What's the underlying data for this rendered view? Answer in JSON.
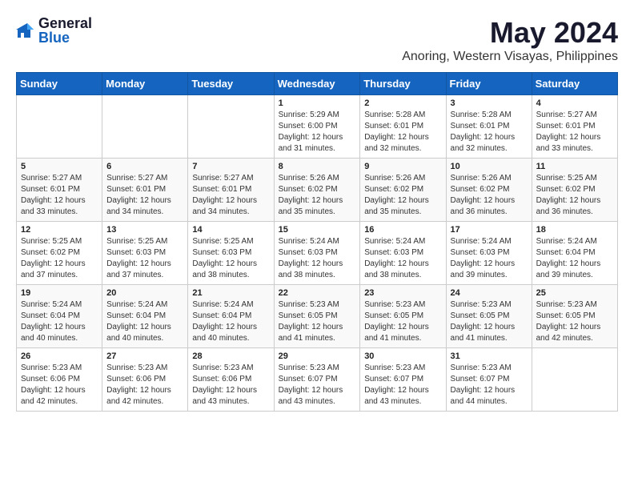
{
  "logo": {
    "general": "General",
    "blue": "Blue"
  },
  "title": "May 2024",
  "location": "Anoring, Western Visayas, Philippines",
  "weekdays": [
    "Sunday",
    "Monday",
    "Tuesday",
    "Wednesday",
    "Thursday",
    "Friday",
    "Saturday"
  ],
  "weeks": [
    [
      {
        "day": "",
        "info": ""
      },
      {
        "day": "",
        "info": ""
      },
      {
        "day": "",
        "info": ""
      },
      {
        "day": "1",
        "info": "Sunrise: 5:29 AM\nSunset: 6:00 PM\nDaylight: 12 hours\nand 31 minutes."
      },
      {
        "day": "2",
        "info": "Sunrise: 5:28 AM\nSunset: 6:01 PM\nDaylight: 12 hours\nand 32 minutes."
      },
      {
        "day": "3",
        "info": "Sunrise: 5:28 AM\nSunset: 6:01 PM\nDaylight: 12 hours\nand 32 minutes."
      },
      {
        "day": "4",
        "info": "Sunrise: 5:27 AM\nSunset: 6:01 PM\nDaylight: 12 hours\nand 33 minutes."
      }
    ],
    [
      {
        "day": "5",
        "info": "Sunrise: 5:27 AM\nSunset: 6:01 PM\nDaylight: 12 hours\nand 33 minutes."
      },
      {
        "day": "6",
        "info": "Sunrise: 5:27 AM\nSunset: 6:01 PM\nDaylight: 12 hours\nand 34 minutes."
      },
      {
        "day": "7",
        "info": "Sunrise: 5:27 AM\nSunset: 6:01 PM\nDaylight: 12 hours\nand 34 minutes."
      },
      {
        "day": "8",
        "info": "Sunrise: 5:26 AM\nSunset: 6:02 PM\nDaylight: 12 hours\nand 35 minutes."
      },
      {
        "day": "9",
        "info": "Sunrise: 5:26 AM\nSunset: 6:02 PM\nDaylight: 12 hours\nand 35 minutes."
      },
      {
        "day": "10",
        "info": "Sunrise: 5:26 AM\nSunset: 6:02 PM\nDaylight: 12 hours\nand 36 minutes."
      },
      {
        "day": "11",
        "info": "Sunrise: 5:25 AM\nSunset: 6:02 PM\nDaylight: 12 hours\nand 36 minutes."
      }
    ],
    [
      {
        "day": "12",
        "info": "Sunrise: 5:25 AM\nSunset: 6:02 PM\nDaylight: 12 hours\nand 37 minutes."
      },
      {
        "day": "13",
        "info": "Sunrise: 5:25 AM\nSunset: 6:03 PM\nDaylight: 12 hours\nand 37 minutes."
      },
      {
        "day": "14",
        "info": "Sunrise: 5:25 AM\nSunset: 6:03 PM\nDaylight: 12 hours\nand 38 minutes."
      },
      {
        "day": "15",
        "info": "Sunrise: 5:24 AM\nSunset: 6:03 PM\nDaylight: 12 hours\nand 38 minutes."
      },
      {
        "day": "16",
        "info": "Sunrise: 5:24 AM\nSunset: 6:03 PM\nDaylight: 12 hours\nand 38 minutes."
      },
      {
        "day": "17",
        "info": "Sunrise: 5:24 AM\nSunset: 6:03 PM\nDaylight: 12 hours\nand 39 minutes."
      },
      {
        "day": "18",
        "info": "Sunrise: 5:24 AM\nSunset: 6:04 PM\nDaylight: 12 hours\nand 39 minutes."
      }
    ],
    [
      {
        "day": "19",
        "info": "Sunrise: 5:24 AM\nSunset: 6:04 PM\nDaylight: 12 hours\nand 40 minutes."
      },
      {
        "day": "20",
        "info": "Sunrise: 5:24 AM\nSunset: 6:04 PM\nDaylight: 12 hours\nand 40 minutes."
      },
      {
        "day": "21",
        "info": "Sunrise: 5:24 AM\nSunset: 6:04 PM\nDaylight: 12 hours\nand 40 minutes."
      },
      {
        "day": "22",
        "info": "Sunrise: 5:23 AM\nSunset: 6:05 PM\nDaylight: 12 hours\nand 41 minutes."
      },
      {
        "day": "23",
        "info": "Sunrise: 5:23 AM\nSunset: 6:05 PM\nDaylight: 12 hours\nand 41 minutes."
      },
      {
        "day": "24",
        "info": "Sunrise: 5:23 AM\nSunset: 6:05 PM\nDaylight: 12 hours\nand 41 minutes."
      },
      {
        "day": "25",
        "info": "Sunrise: 5:23 AM\nSunset: 6:05 PM\nDaylight: 12 hours\nand 42 minutes."
      }
    ],
    [
      {
        "day": "26",
        "info": "Sunrise: 5:23 AM\nSunset: 6:06 PM\nDaylight: 12 hours\nand 42 minutes."
      },
      {
        "day": "27",
        "info": "Sunrise: 5:23 AM\nSunset: 6:06 PM\nDaylight: 12 hours\nand 42 minutes."
      },
      {
        "day": "28",
        "info": "Sunrise: 5:23 AM\nSunset: 6:06 PM\nDaylight: 12 hours\nand 43 minutes."
      },
      {
        "day": "29",
        "info": "Sunrise: 5:23 AM\nSunset: 6:07 PM\nDaylight: 12 hours\nand 43 minutes."
      },
      {
        "day": "30",
        "info": "Sunrise: 5:23 AM\nSunset: 6:07 PM\nDaylight: 12 hours\nand 43 minutes."
      },
      {
        "day": "31",
        "info": "Sunrise: 5:23 AM\nSunset: 6:07 PM\nDaylight: 12 hours\nand 44 minutes."
      },
      {
        "day": "",
        "info": ""
      }
    ]
  ]
}
